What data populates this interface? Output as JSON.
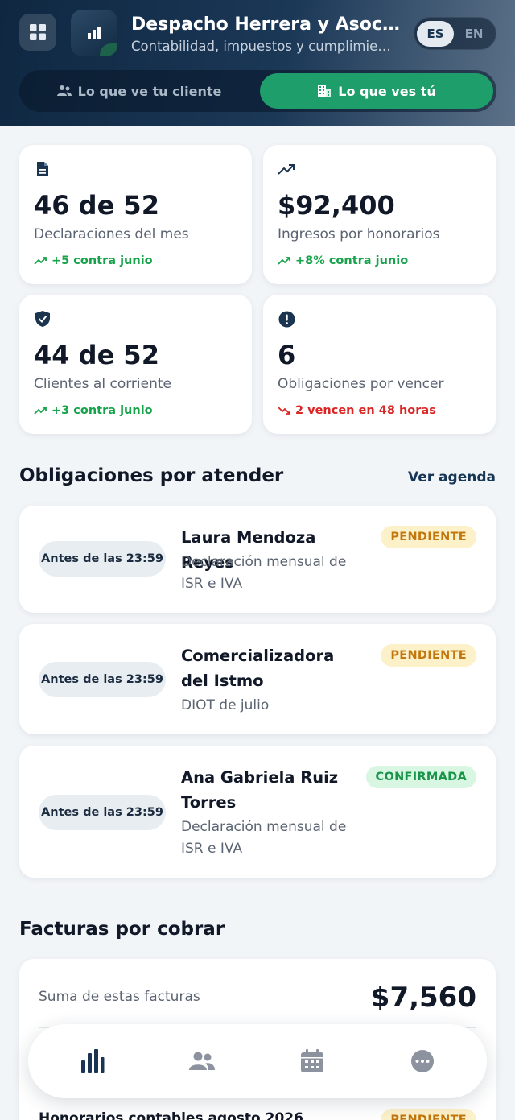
{
  "header": {
    "firm_name": "Despacho Herrera y Asociados",
    "firm_subtitle": "Contabilidad, impuestos y cumplimiento fiscal",
    "language": {
      "es": "ES",
      "en": "EN",
      "selected": "ES"
    },
    "view_toggle": {
      "client_label": "Lo que ve tu cliente",
      "you_label": "Lo que ves tú",
      "selected": "you"
    }
  },
  "stats": [
    {
      "icon": "document-icon",
      "value": "46 de 52",
      "label": "Declaraciones del mes",
      "trend": "+5 contra junio",
      "trend_dir": "up"
    },
    {
      "icon": "trending-up-icon",
      "value": "$92,400",
      "label": "Ingresos por honorarios",
      "trend": "+8% contra junio",
      "trend_dir": "up"
    },
    {
      "icon": "shield-check-icon",
      "value": "44 de 52",
      "label": "Clientes al corriente",
      "trend": "+3 contra junio",
      "trend_dir": "up"
    },
    {
      "icon": "alert-circle-icon",
      "value": "6",
      "label": "Obligaciones por vencer",
      "trend": "2 vencen en 48 horas",
      "trend_dir": "down"
    }
  ],
  "obligations": {
    "title": "Obligaciones por atender",
    "link": "Ver agenda",
    "items": [
      {
        "due": "Antes de las 23:59",
        "client": "Laura Mendoza Reyes",
        "task": "Declaración mensual de ISR e IVA",
        "status": "PENDIENTE"
      },
      {
        "due": "Antes de las 23:59",
        "client": "Comercializadora del Istmo",
        "task": "DIOT de julio",
        "status": "PENDIENTE"
      },
      {
        "due": "Antes de las 23:59",
        "client": "Ana Gabriela Ruiz Torres",
        "task": "Declaración mensual de ISR e IVA",
        "status": "CONFIRMADA"
      }
    ]
  },
  "invoices": {
    "title": "Facturas por cobrar",
    "sum_label": "Suma de estas facturas",
    "sum_value": "$7,560",
    "first_row": {
      "title": "Honorarios contables agosto 2026",
      "status": "PENDIENTE"
    }
  },
  "colors": {
    "accent_green": "#1e9e6a",
    "navy": "#0f2741",
    "pending": "#c2760c",
    "confirmed": "#189548",
    "danger": "#dc2626"
  },
  "bottom_nav": [
    {
      "icon": "bar-chart-icon",
      "active": true
    },
    {
      "icon": "users-icon",
      "active": false
    },
    {
      "icon": "calendar-icon",
      "active": false
    },
    {
      "icon": "more-icon",
      "active": false
    }
  ]
}
